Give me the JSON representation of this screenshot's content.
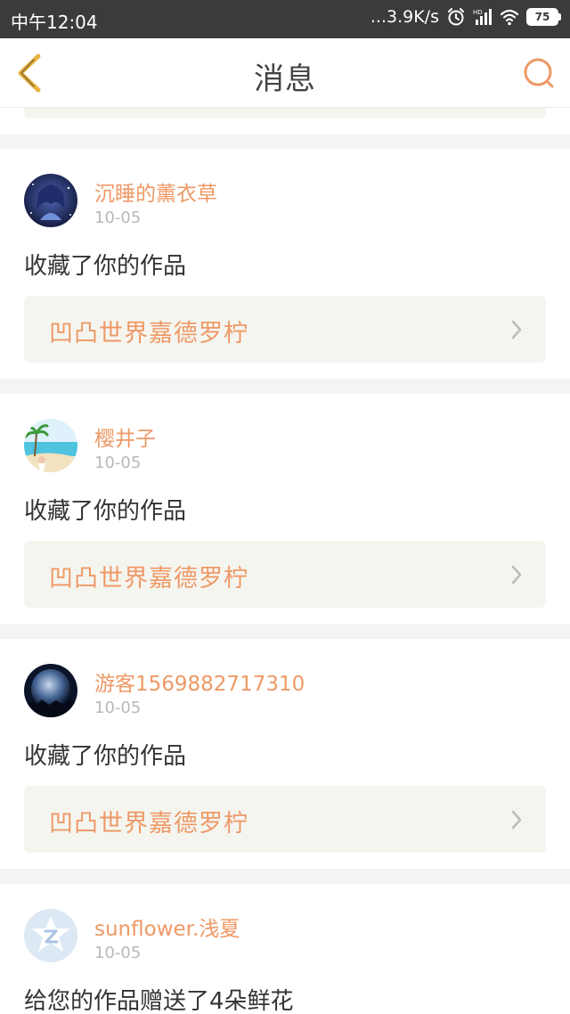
{
  "status_bar": {
    "time": "中午12:04",
    "net_speed": "...3.9K/s",
    "battery": "75"
  },
  "nav": {
    "title": "消息",
    "back_icon": "chevron-left-icon",
    "search_icon": "search-icon"
  },
  "colors": {
    "accent": "#ee9966",
    "status_bar_bg": "#3b3b3b",
    "page_bg": "#f4f4f4",
    "link_bg": "#f5f5f0"
  },
  "messages": [
    {
      "username": "沉睡的薰衣草",
      "date": "10-05",
      "action": "收藏了你的作品",
      "work_title": "凹凸世界嘉德罗柠",
      "avatar": "anime-girl-avatar"
    },
    {
      "username": "樱井子",
      "date": "10-05",
      "action": "收藏了你的作品",
      "work_title": "凹凸世界嘉德罗柠",
      "avatar": "beach-avatar"
    },
    {
      "username": "游客1569882717310",
      "date": "10-05",
      "action": "收藏了你的作品",
      "work_title": "凹凸世界嘉德罗柠",
      "avatar": "earth-avatar"
    },
    {
      "username": "sunflower.浅夏",
      "date": "10-05",
      "action": "给您的作品赠送了4朵鲜花",
      "avatar": "default-avatar"
    }
  ]
}
